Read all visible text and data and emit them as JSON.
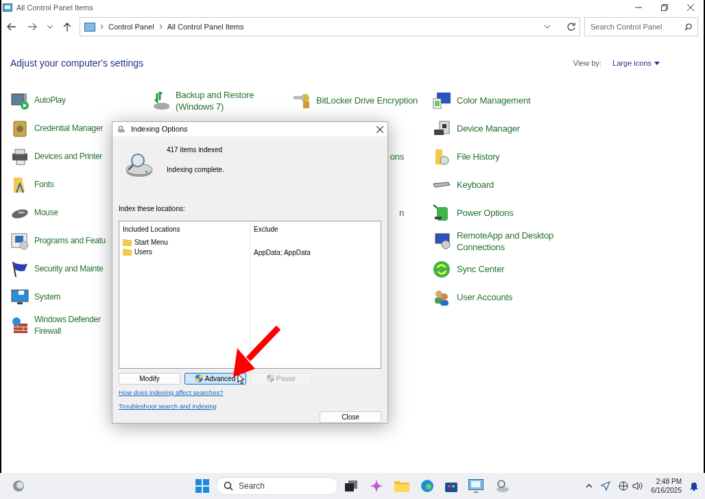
{
  "window": {
    "title": "All Control Panel Items"
  },
  "address_bar": {
    "path": [
      "Control Panel",
      "All Control Panel Items"
    ]
  },
  "search": {
    "placeholder": "Search Control Panel"
  },
  "heading": "Adjust your computer's settings",
  "view_by": {
    "label": "View by:",
    "value": "Large icons"
  },
  "rows": [
    [
      "AutoPlay",
      "Backup and Restore (Windows 7)",
      "BitLocker Drive Encryption",
      "Color Management"
    ],
    [
      "Credential Manager",
      null,
      null,
      "Device Manager"
    ],
    [
      "Devices and Printer",
      null,
      "ons",
      "File History"
    ],
    [
      "Fonts",
      null,
      null,
      "Keyboard"
    ],
    [
      "Mouse",
      null,
      "n",
      "Power Options"
    ],
    [
      "Programs and Featu",
      null,
      null,
      "RemoteApp and Desktop Connections"
    ],
    [
      "Security and Mainte",
      null,
      null,
      "Sync Center"
    ],
    [
      "System",
      null,
      null,
      "User Accounts"
    ],
    [
      "Windows Defender Firewall",
      null,
      null,
      null
    ]
  ],
  "dialog": {
    "title": "Indexing Options",
    "count": "417 items indexed",
    "status": "Indexing complete.",
    "list_label": "Index these locations:",
    "columns": [
      "Included Locations",
      "Exclude"
    ],
    "locations": [
      {
        "name": "Start Menu"
      },
      {
        "name": "Users",
        "exclude": "AppData; AppData"
      }
    ],
    "buttons": [
      {
        "label": "Modify",
        "kind": "plain",
        "disabled": false,
        "hovered": false
      },
      {
        "label": "Advanced",
        "kind": "shield",
        "disabled": false,
        "hovered": true
      },
      {
        "label": "Pause",
        "kind": "shield",
        "disabled": true,
        "hovered": false
      }
    ],
    "links": [
      "How does indexing affect searches?",
      "Troubleshoot search and indexing"
    ],
    "close": "Close"
  },
  "taskbar": {
    "search_placeholder": "Search",
    "time": "2:48 PM",
    "date": "6/16/2025"
  }
}
